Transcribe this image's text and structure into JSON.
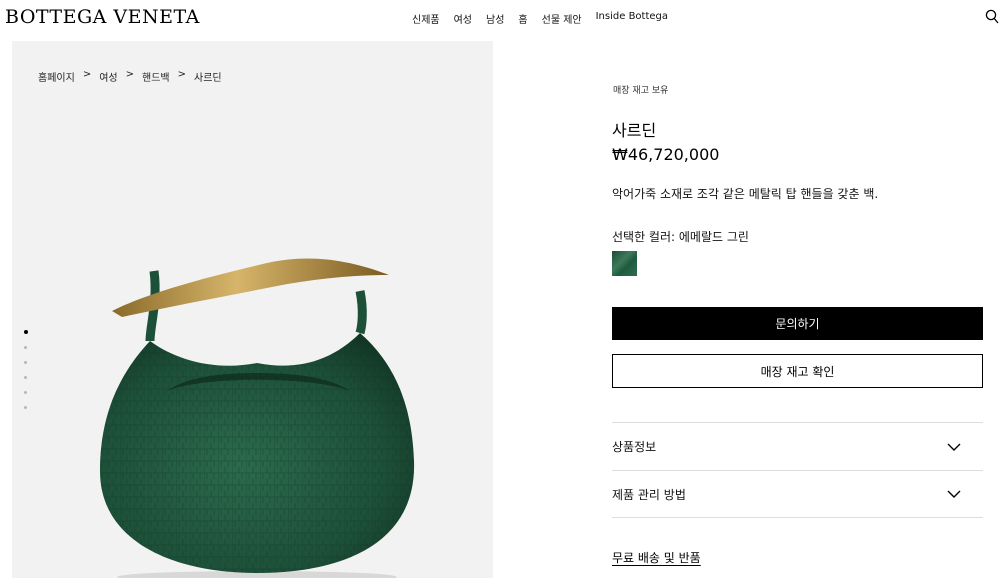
{
  "header": {
    "logo": "BOTTEGA VENETA",
    "nav": [
      "신제품",
      "여성",
      "남성",
      "홈",
      "선물 제안",
      "Inside Bottega"
    ]
  },
  "breadcrumb": [
    "홈페이지",
    ">",
    "여성",
    ">",
    "핸드백",
    ">",
    "사르딘"
  ],
  "gallery": {
    "slide_count": 6,
    "active_slide": 1
  },
  "product": {
    "stock_label": "매장 재고 보유",
    "title": "사르딘",
    "price": "₩46,720,000",
    "description": "악어가죽 소재로 조각 같은 메탈릭 탑 핸들을 갖춘 백.",
    "color_label": "선택한 컬러: 에메랄드 그린",
    "swatch_color": "#1f5a40",
    "inquire_button": "문의하기",
    "stock_check_button": "매장 재고 확인",
    "accordion": [
      "상품정보",
      "제품 관리 방법"
    ],
    "shipping_link": "무료 배송 및 반품"
  }
}
